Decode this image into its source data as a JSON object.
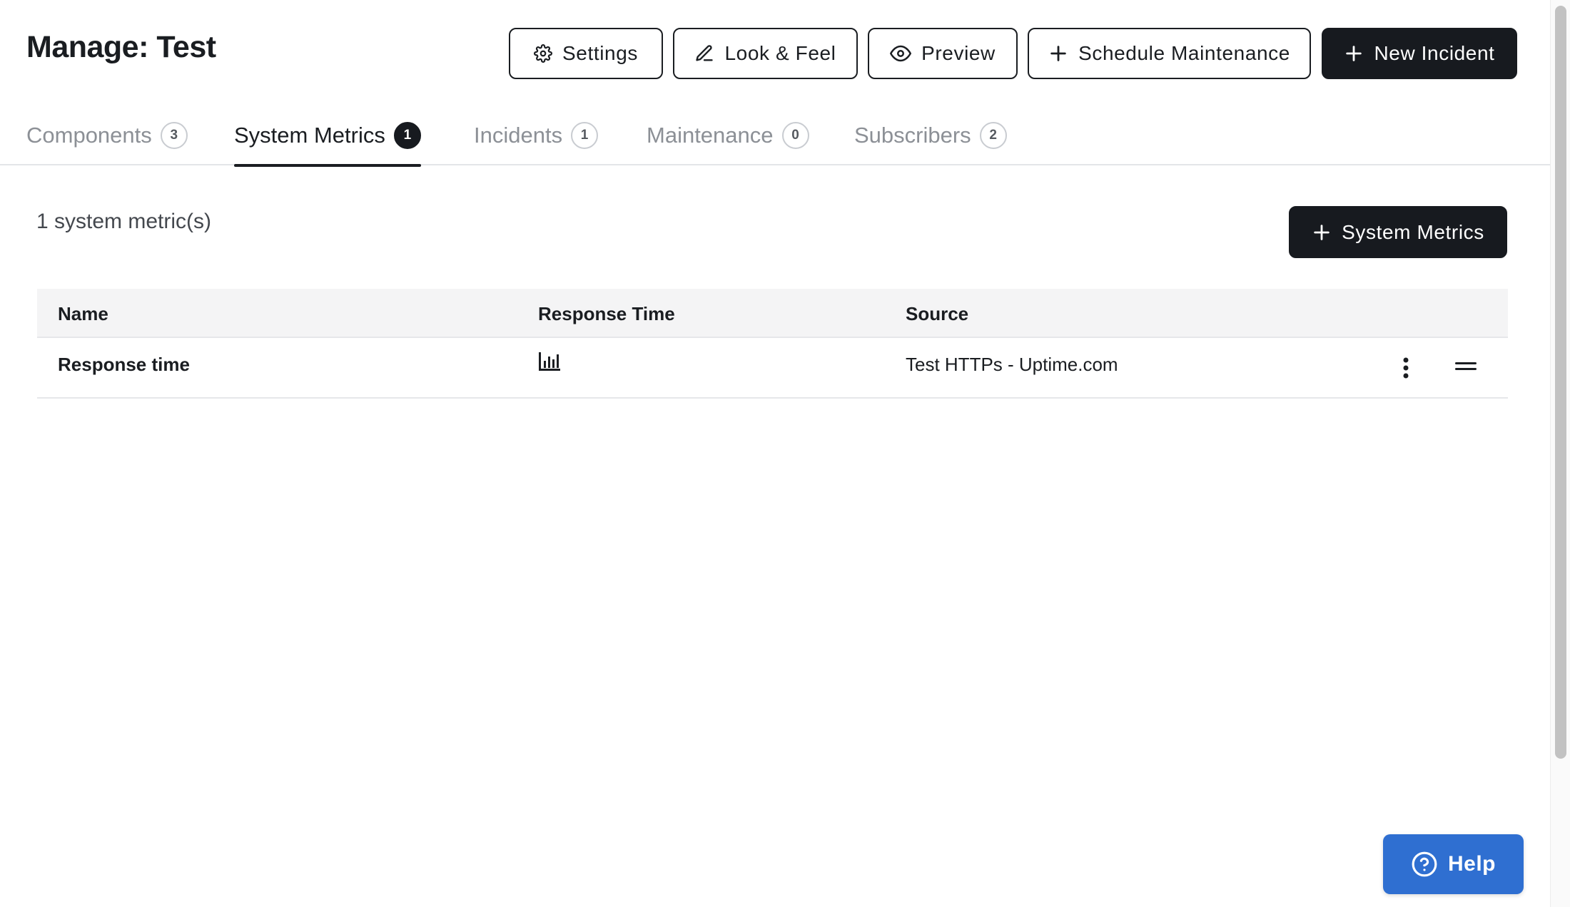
{
  "header": {
    "title": "Manage: Test",
    "buttons": {
      "settings": "Settings",
      "look_feel": "Look & Feel",
      "preview": "Preview",
      "schedule_maintenance": "Schedule Maintenance",
      "new_incident": "New Incident"
    }
  },
  "tabs": [
    {
      "label": "Components",
      "count": "3",
      "active": false
    },
    {
      "label": "System Metrics",
      "count": "1",
      "active": true
    },
    {
      "label": "Incidents",
      "count": "1",
      "active": false
    },
    {
      "label": "Maintenance",
      "count": "0",
      "active": false
    },
    {
      "label": "Subscribers",
      "count": "2",
      "active": false
    }
  ],
  "content": {
    "summary": "1 system metric(s)",
    "add_button": "System Metrics"
  },
  "table": {
    "columns": [
      "Name",
      "Response Time",
      "Source"
    ],
    "rows": [
      {
        "name": "Response time",
        "response_icon": "bar-chart-icon",
        "source": "Test HTTPs - Uptime.com"
      }
    ]
  },
  "help": {
    "label": "Help"
  },
  "colors": {
    "dark": "#171a1f",
    "help_blue": "#2f6fd1",
    "muted": "#8c9096"
  }
}
